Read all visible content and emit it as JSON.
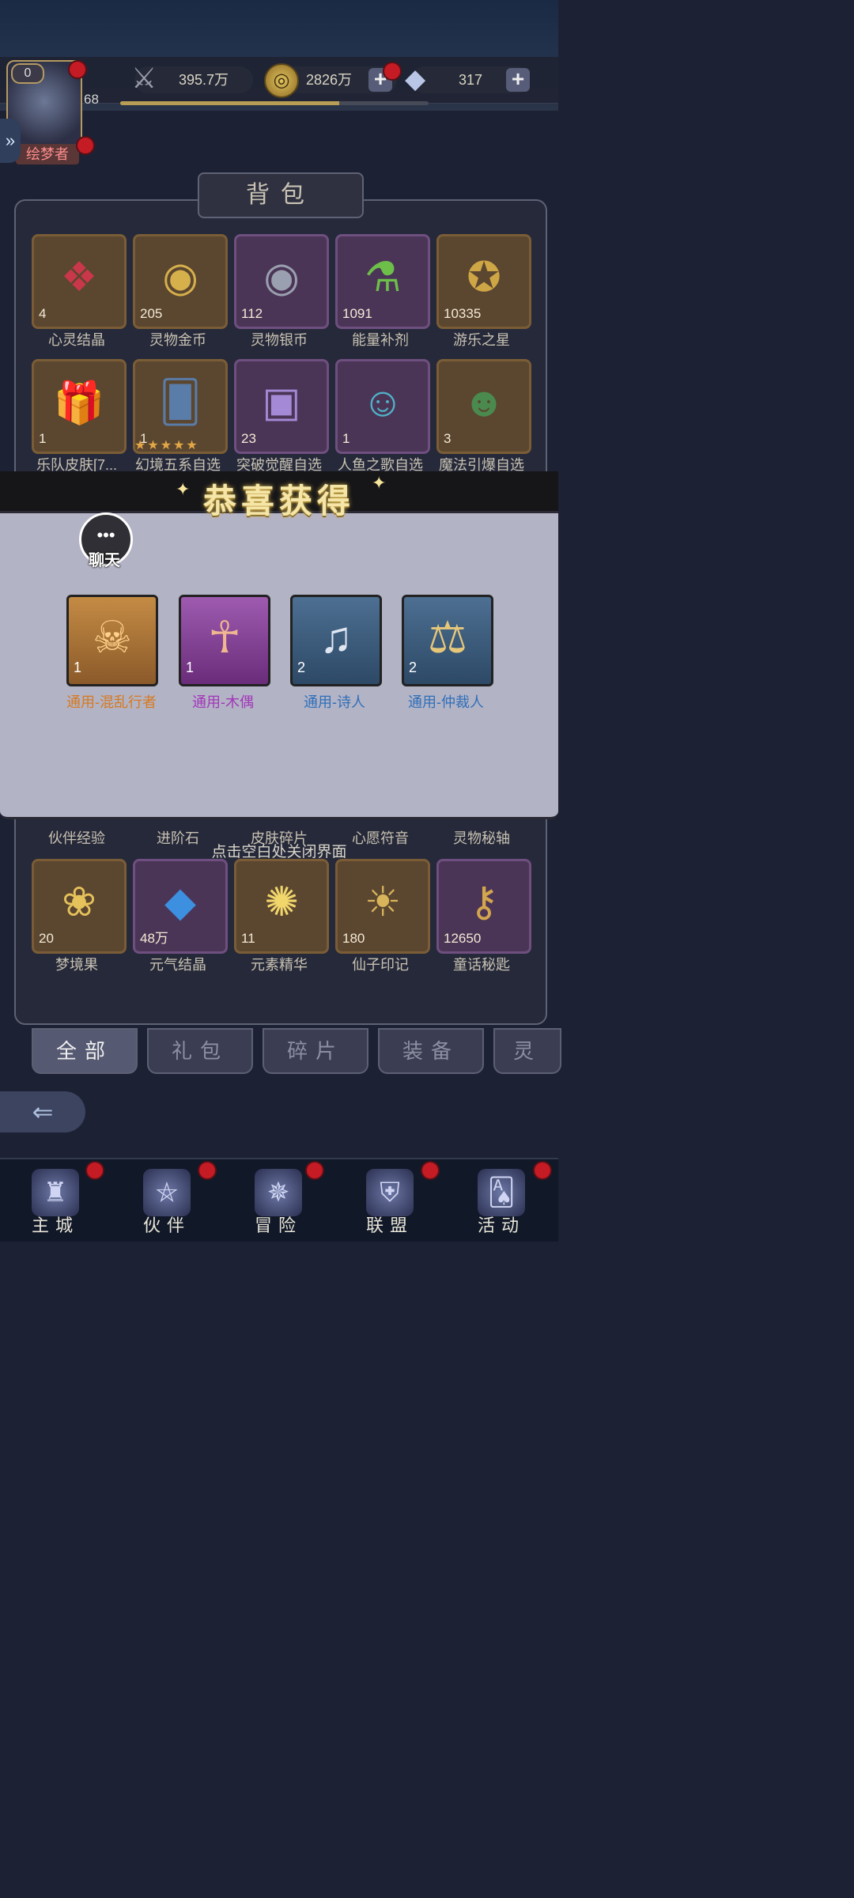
{
  "header": {
    "avatar_badge": "0",
    "player_level": "68",
    "player_name": "绘梦者",
    "xp_progress": 0.71,
    "resources": [
      {
        "name": "power",
        "icon": "sword-icon",
        "value": "395.7万"
      },
      {
        "name": "coins",
        "icon": "coin-icon",
        "value": "2826万"
      },
      {
        "name": "gems",
        "icon": "diamond-icon",
        "value": "317"
      }
    ],
    "plus_symbol": "+"
  },
  "backpack": {
    "title": "背包",
    "row1": [
      {
        "label": "心灵结晶",
        "count": "4",
        "icon": "crystal-icon",
        "color": "#c9374a"
      },
      {
        "label": "灵物金币",
        "count": "205",
        "icon": "gold-medal-icon",
        "color": "#d6b04a"
      },
      {
        "label": "灵物银币",
        "count": "112",
        "icon": "silver-medal-icon",
        "color": "#9aa0b0"
      },
      {
        "label": "能量补剂",
        "count": "1091",
        "icon": "potion-icon",
        "color": "#6dbf4a"
      },
      {
        "label": "游乐之星",
        "count": "10335",
        "icon": "star-coin-icon",
        "color": "#cfa645"
      }
    ],
    "row2": [
      {
        "label": "乐队皮肤[7...",
        "count": "1",
        "icon": "gift-box-icon",
        "color": "#c8912c"
      },
      {
        "label": "幻境五系自选",
        "count": "1",
        "icon": "card-icon",
        "color": "#5a7ca8"
      },
      {
        "label": "突破觉醒自选",
        "count": "23",
        "icon": "purple-gift-icon",
        "color": "#8a6fc3"
      },
      {
        "label": "人鱼之歌自选",
        "count": "1",
        "icon": "mermaid-icon",
        "color": "#4fb3c9"
      },
      {
        "label": "魔法引爆自选",
        "count": "3",
        "icon": "witch-icon",
        "color": "#4b8a4e"
      }
    ],
    "row2_stars": "★★★★★",
    "row_lower_labels": [
      "伙伴经验",
      "进阶石",
      "皮肤碎片",
      "心愿符音",
      "灵物秘轴"
    ],
    "row3": [
      {
        "label": "梦境果",
        "count": "20",
        "icon": "dream-fruit-icon",
        "color": "#e6c25a"
      },
      {
        "label": "元气结晶",
        "count": "48万",
        "icon": "blue-crystal-icon",
        "color": "#3d8fe0"
      },
      {
        "label": "元素精华",
        "count": "11",
        "icon": "essence-icon",
        "color": "#f0d66b"
      },
      {
        "label": "仙子印记",
        "count": "180",
        "icon": "sun-seal-icon",
        "color": "#d8b55a"
      },
      {
        "label": "童话秘匙",
        "count": "12650",
        "icon": "key-icon",
        "color": "#d3a54d"
      }
    ]
  },
  "reward_modal": {
    "title": "恭喜获得",
    "chat_label": "聊天",
    "chat_icon": "chat-bubble-icon",
    "items": [
      {
        "label": "通用-混乱行者",
        "count": "1",
        "icon": "demon-mask-icon",
        "label_color": "#d67a1e",
        "frame": "gold"
      },
      {
        "label": "通用-木偶",
        "count": "1",
        "icon": "puppet-icon",
        "label_color": "#a237b8",
        "frame": "violet"
      },
      {
        "label": "通用-诗人",
        "count": "2",
        "icon": "lyre-icon",
        "label_color": "#2f6fb8",
        "frame": "blue"
      },
      {
        "label": "通用-仲裁人",
        "count": "2",
        "icon": "scales-icon",
        "label_color": "#2f6fb8",
        "frame": "blue"
      }
    ],
    "close_hint": "点击空白处关闭界面"
  },
  "tabs": [
    {
      "label": "全部",
      "active": true
    },
    {
      "label": "礼包",
      "active": false
    },
    {
      "label": "碎片",
      "active": false
    },
    {
      "label": "装备",
      "active": false
    },
    {
      "label": "灵",
      "active": false
    }
  ],
  "bottom_nav": [
    {
      "label": "主城",
      "icon": "castle-icon"
    },
    {
      "label": "伙伴",
      "icon": "witch-hat-icon"
    },
    {
      "label": "冒险",
      "icon": "compass-icon"
    },
    {
      "label": "联盟",
      "icon": "shield-icon"
    },
    {
      "label": "活动",
      "icon": "cards-icon"
    }
  ]
}
